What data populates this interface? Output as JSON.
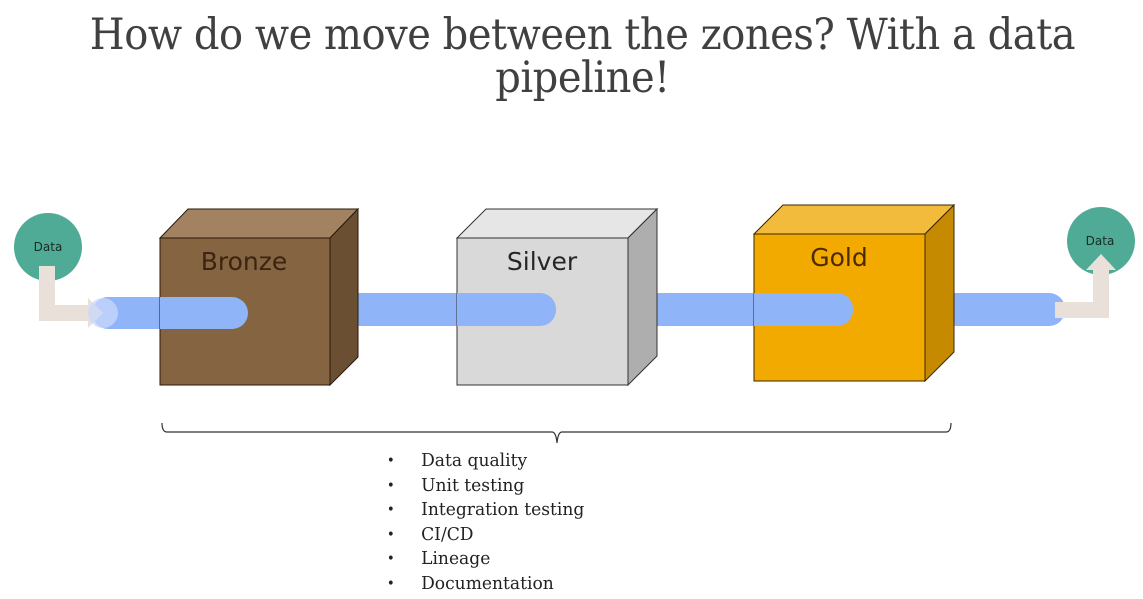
{
  "slide": {
    "title": "How do we move between the zones? With a data pipeline!"
  },
  "diagram": {
    "source_node": {
      "label": "Data",
      "color": "#4fab96"
    },
    "target_node": {
      "label": "Data",
      "color": "#4fab96"
    },
    "pipe_color": "#8fb4f8",
    "arrow_color": "#e8e0d9",
    "zones": [
      {
        "label": "Bronze",
        "front": "#856441",
        "top": "#a28260",
        "side": "#6a4f33",
        "text_color": "#3b2410"
      },
      {
        "label": "Silver",
        "front": "#d9d9d9",
        "top": "#e6e6e6",
        "side": "#aeaeae",
        "text_color": "#262626"
      },
      {
        "label": "Gold",
        "front": "#f2aa00",
        "top": "#f3bb3b",
        "side": "#c58a00",
        "text_color": "#4a2a00"
      }
    ]
  },
  "practices": {
    "bullet": "•",
    "items": [
      "Data quality",
      "Unit testing",
      "Integration testing",
      "CI/CD",
      "Lineage",
      "Documentation"
    ]
  }
}
